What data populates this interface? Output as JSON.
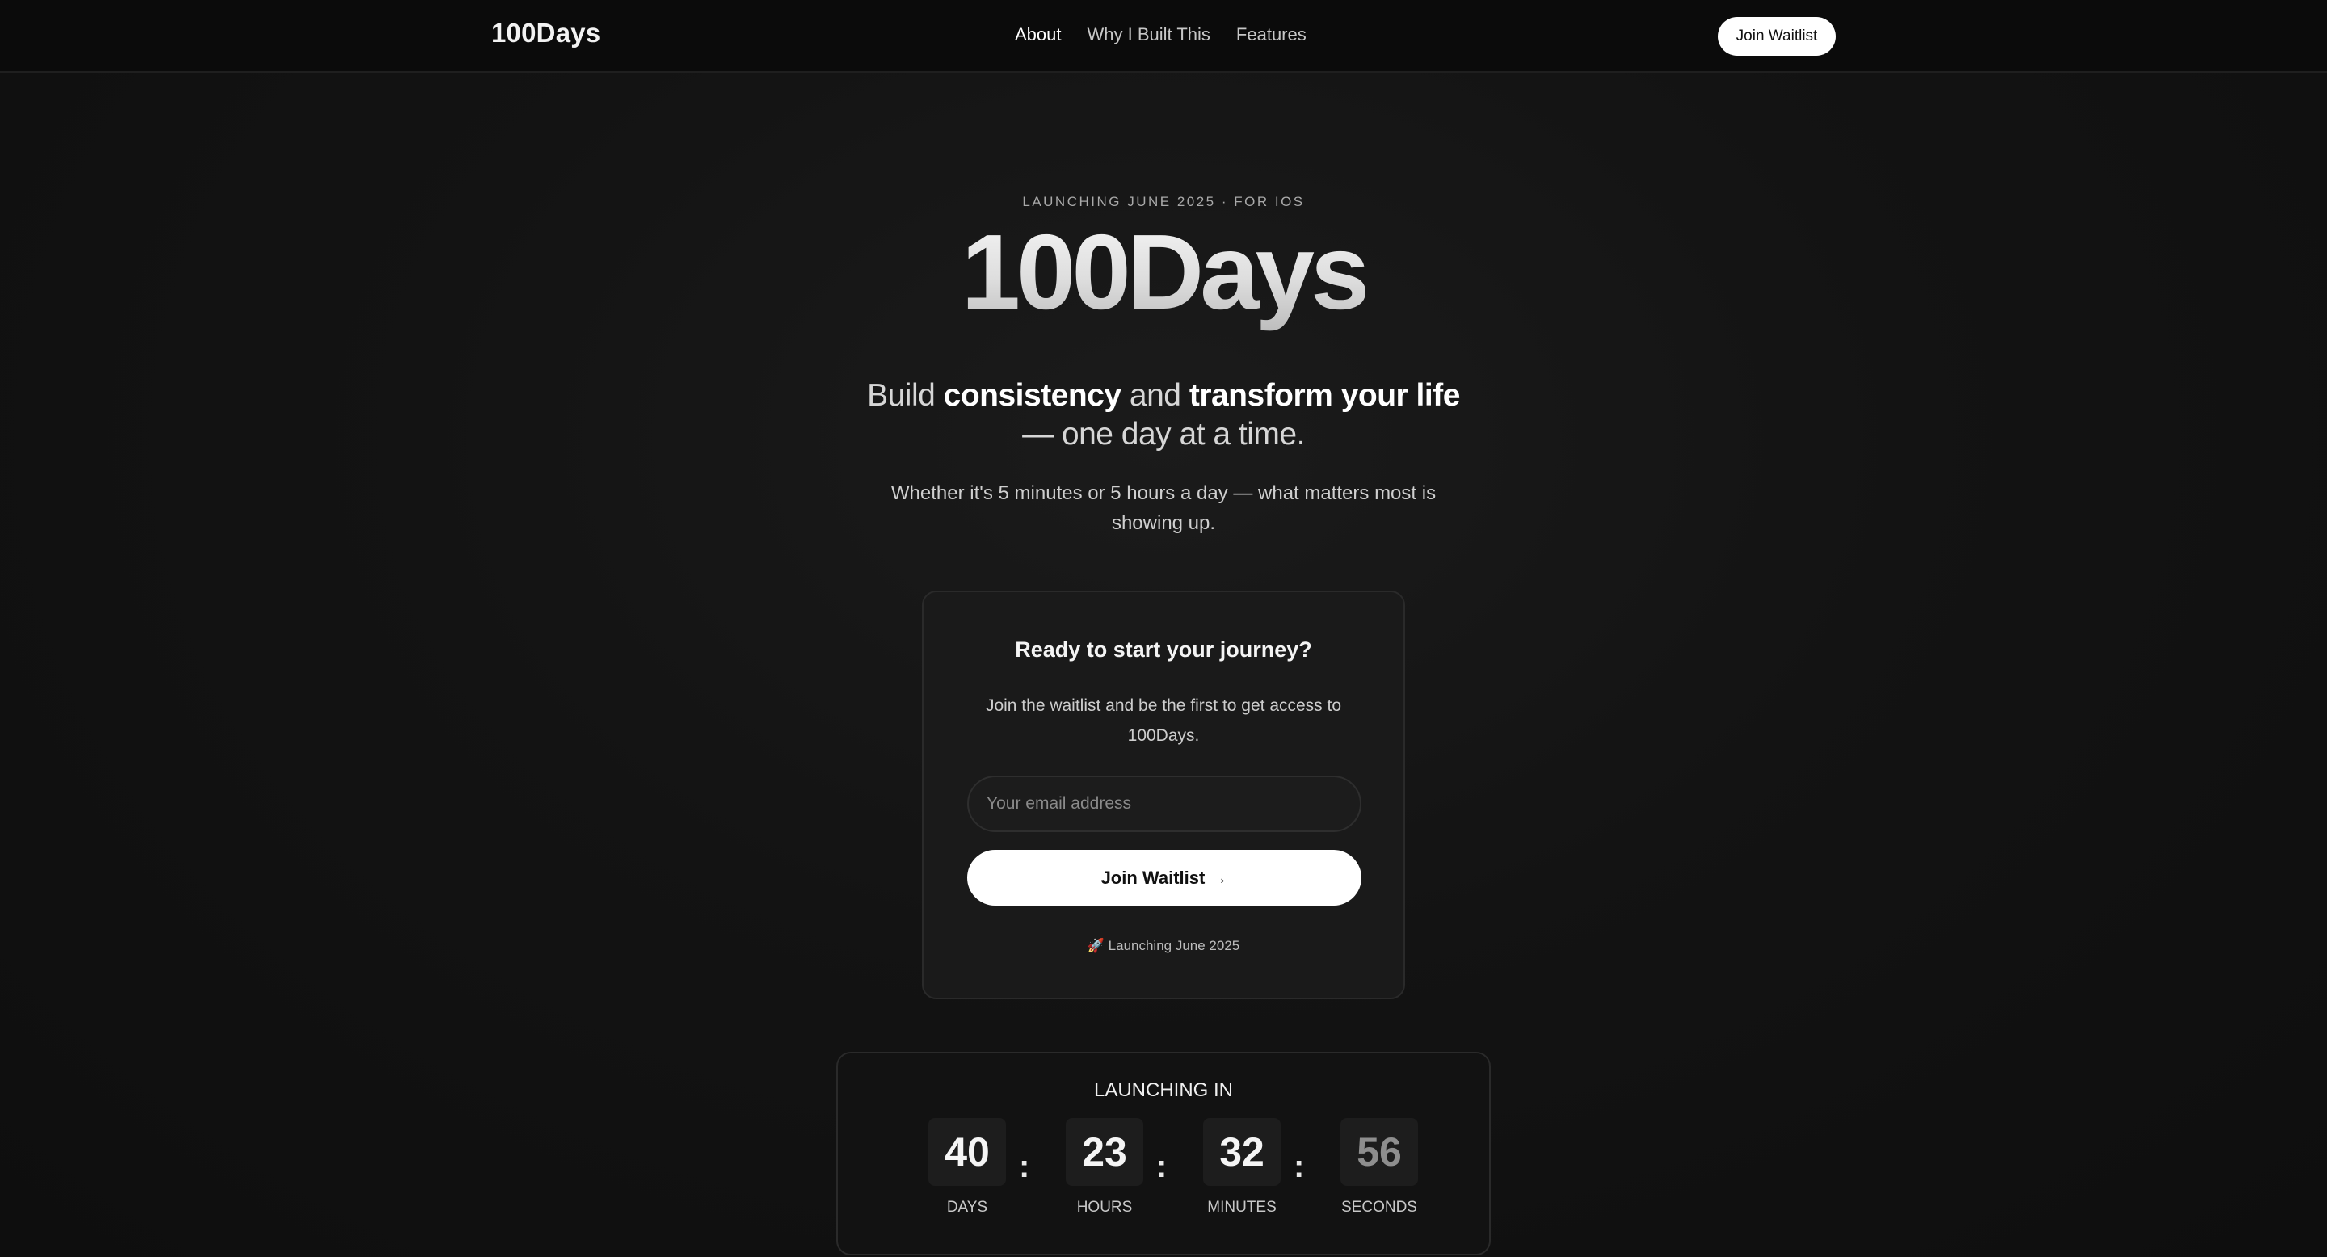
{
  "nav": {
    "brand": "100Days",
    "links": [
      "About",
      "Why I Built This",
      "Features"
    ],
    "cta": "Join Waitlist"
  },
  "hero": {
    "eyebrow": "LAUNCHING JUNE 2025 · FOR IOS",
    "title": "100Days",
    "tagline": {
      "p1": "Build ",
      "b1": "consistency",
      "p2": " and ",
      "b2": "transform your life",
      "p3": "— one day at a time."
    },
    "subtext": "Whether it's 5 minutes or 5 hours a day — what matters most is showing up."
  },
  "waitlist": {
    "title": "Ready to start your journey?",
    "description": "Join the waitlist and be the first to get access to 100Days.",
    "email_placeholder": "Your email address",
    "email_value": "",
    "button": "Join Waitlist →",
    "note_icon": "🚀",
    "note": "Launching June 2025"
  },
  "countdown": {
    "title": "LAUNCHING IN",
    "units": [
      {
        "value": "40",
        "label": "DAYS"
      },
      {
        "value": "23",
        "label": "HOURS"
      },
      {
        "value": "32",
        "label": "MINUTES"
      },
      {
        "value": "56",
        "label": "SECONDS"
      }
    ],
    "separator": ":"
  }
}
